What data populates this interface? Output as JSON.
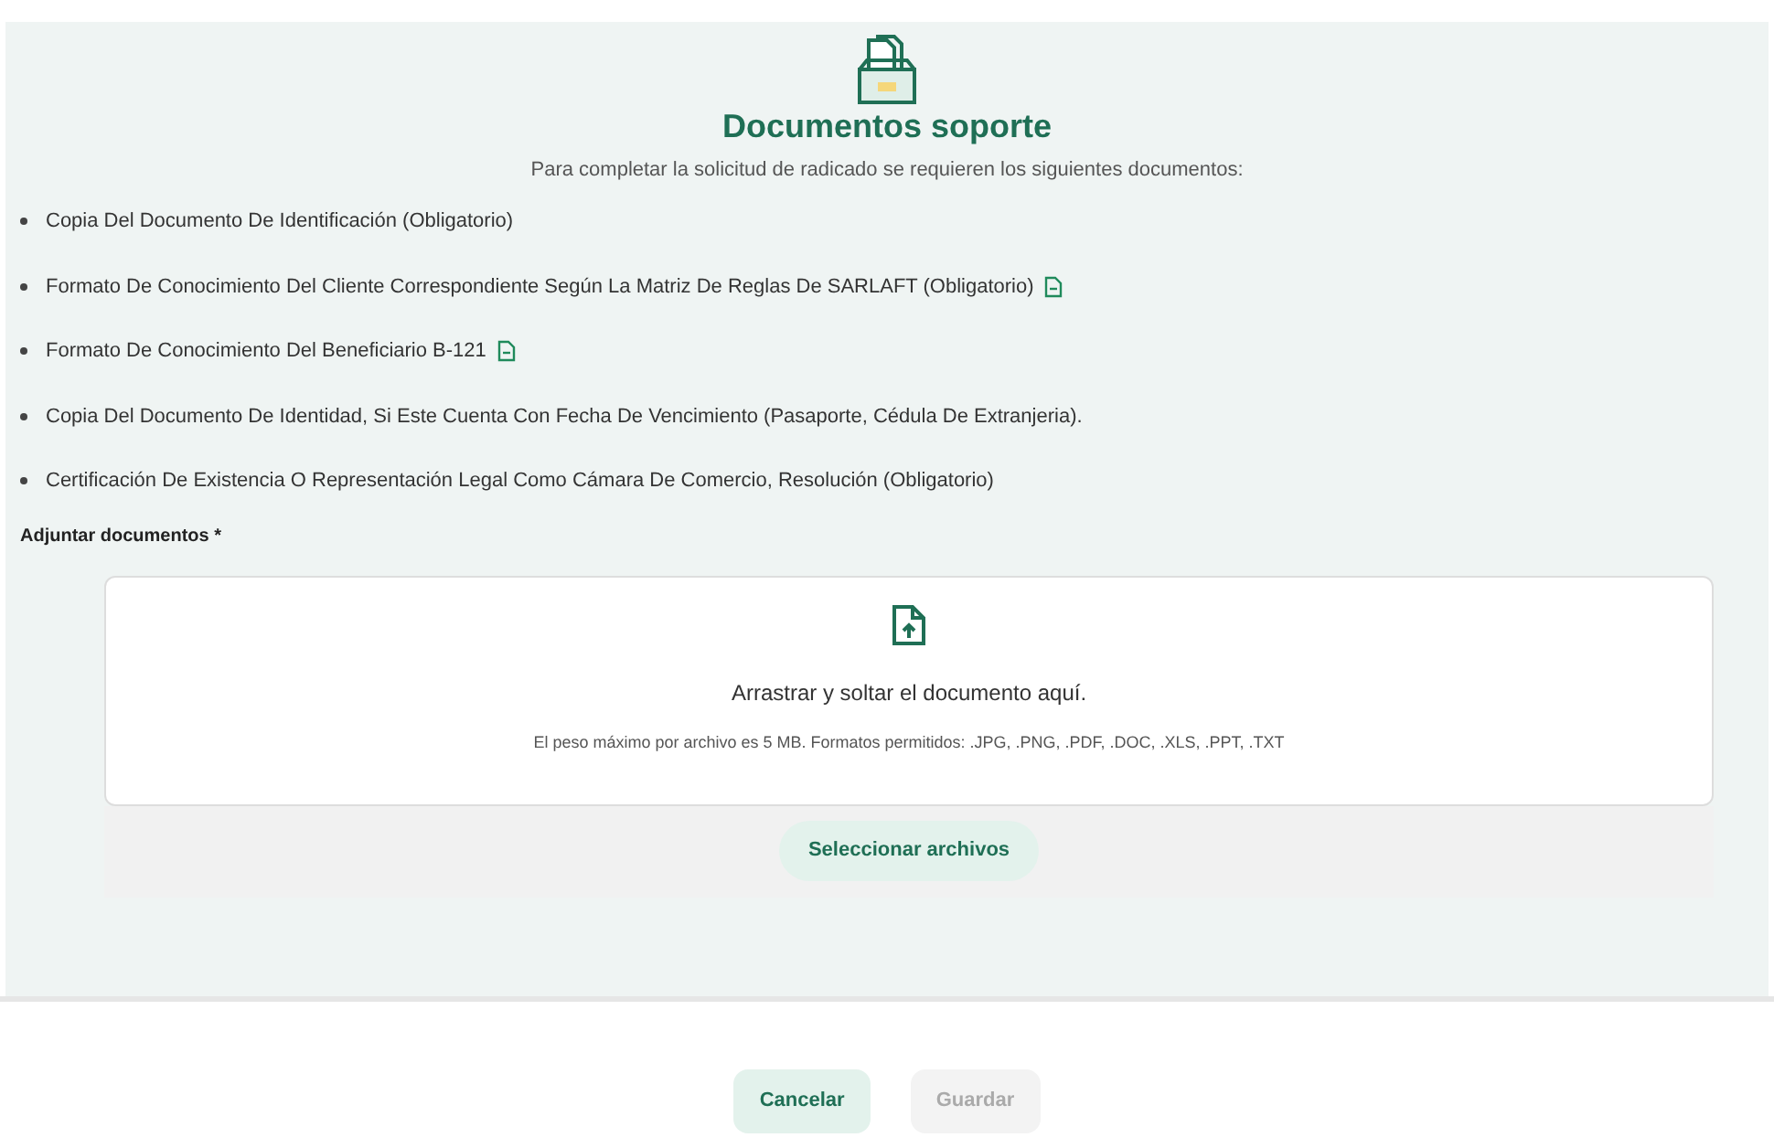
{
  "header": {
    "title": "Documentos soporte",
    "subtitle": "Para completar la solicitud de radicado se requieren los siguientes documentos:"
  },
  "documents": [
    {
      "text": "Copia Del Documento De Identificación (Obligatorio)",
      "template": false
    },
    {
      "text": "Formato De Conocimiento Del Cliente Correspondiente Según La Matriz De Reglas De SARLAFT (Obligatorio)",
      "template": true
    },
    {
      "text": "Formato De Conocimiento Del Beneficiario B-121",
      "template": true
    },
    {
      "text": "Copia Del Documento De Identidad, Si Este Cuenta Con Fecha De Vencimiento (Pasaporte, Cédula De Extranjeria).",
      "template": false
    },
    {
      "text": "Certificación De Existencia O Representación Legal Como Cámara De Comercio, Resolución (Obligatorio)",
      "template": false
    }
  ],
  "upload": {
    "label": "Adjuntar documentos *",
    "drop_text": "Arrastrar y soltar el documento aquí.",
    "hint": "El peso máximo por archivo es 5 MB. Formatos permitidos: .JPG, .PNG, .PDF, .DOC, .XLS, .PPT, .TXT",
    "button": "Seleccionar archivos"
  },
  "actions": [
    {
      "label": "Cancelar",
      "disabled": false
    },
    {
      "label": "Guardar",
      "disabled": true
    }
  ]
}
